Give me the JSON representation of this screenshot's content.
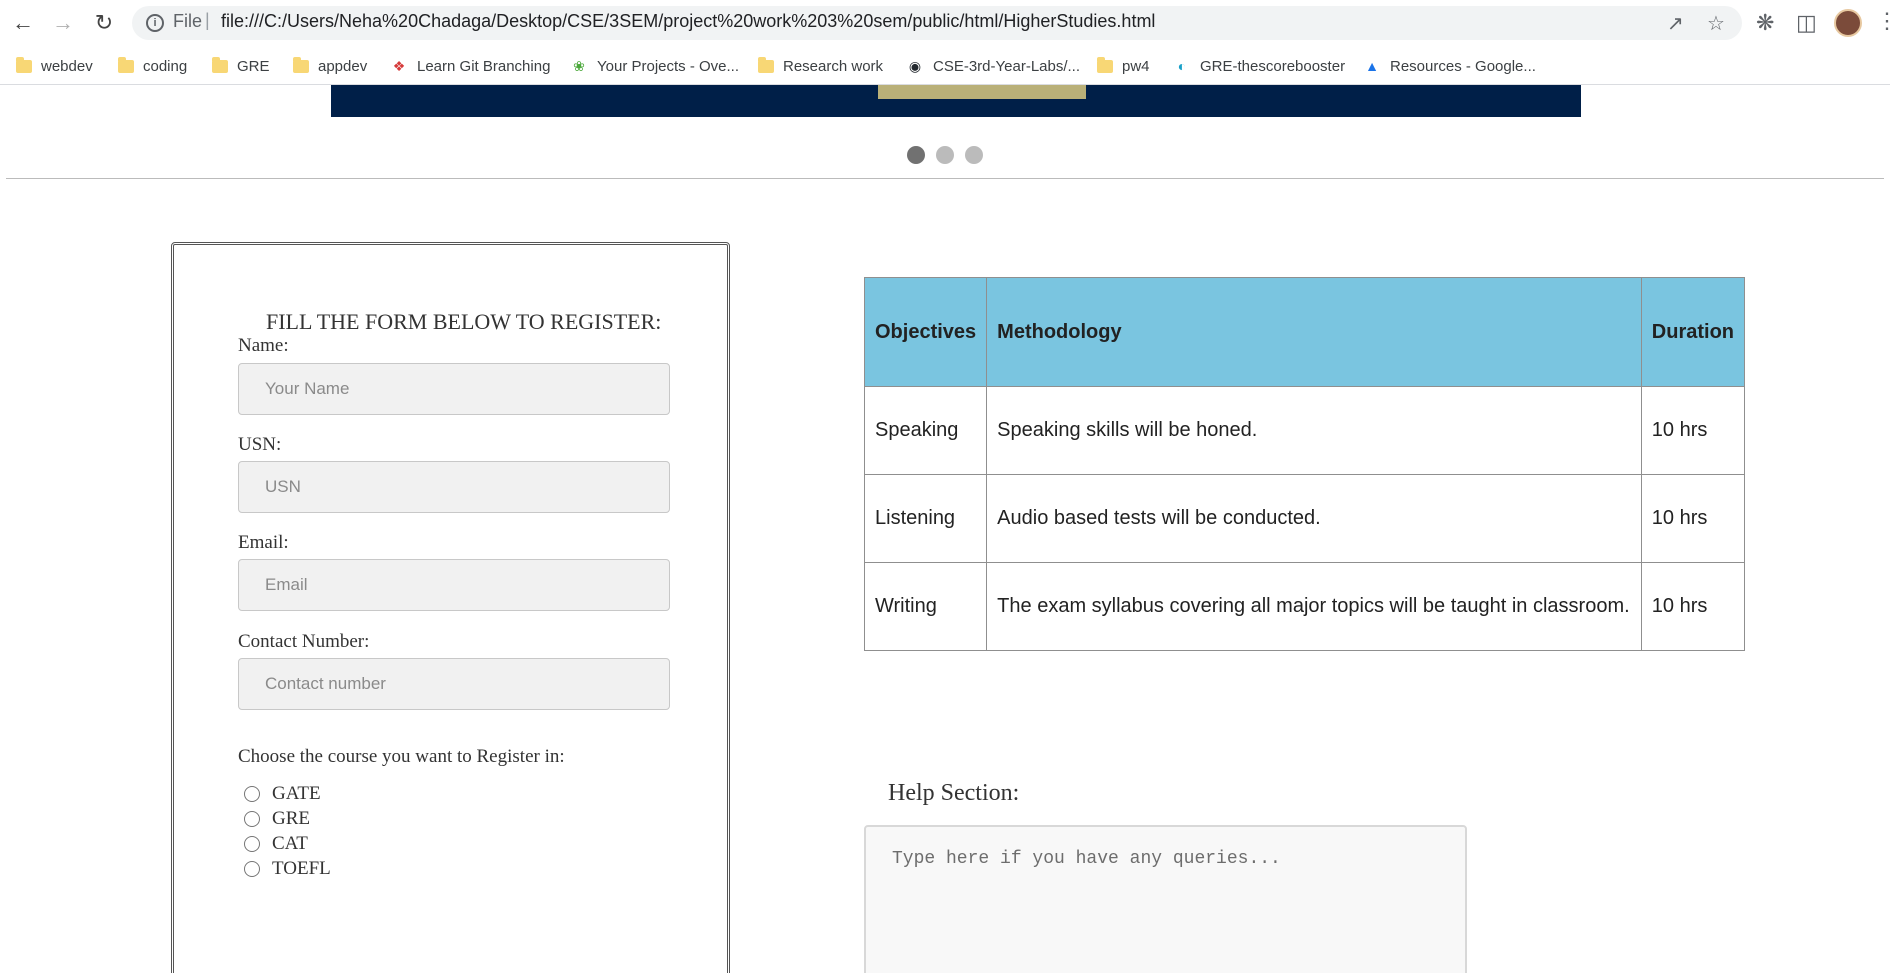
{
  "browser": {
    "url_scheme": "File",
    "url": "file:///C:/Users/Neha%20Chadaga/Desktop/CSE/3SEM/project%20work%203%20sem/public/html/HigherStudies.html",
    "bookmarks": [
      {
        "label": "webdev",
        "icon": "folder-icon"
      },
      {
        "label": "coding",
        "icon": "folder-icon"
      },
      {
        "label": "GRE",
        "icon": "folder-icon"
      },
      {
        "label": "appdev",
        "icon": "folder-icon"
      },
      {
        "label": "Learn Git Branching",
        "icon": "git-branch-icon"
      },
      {
        "label": "Your Projects - Ove...",
        "icon": "leaf-icon"
      },
      {
        "label": "Research work",
        "icon": "folder-icon"
      },
      {
        "label": "CSE-3rd-Year-Labs/...",
        "icon": "github-icon"
      },
      {
        "label": "pw4",
        "icon": "folder-icon"
      },
      {
        "label": "GRE-thescorebooster",
        "icon": "gauge-icon"
      },
      {
        "label": "Resources - Google...",
        "icon": "google-drive-icon"
      }
    ]
  },
  "carousel": {
    "slide_count": 3,
    "active_index": 0,
    "banner_color": "#001f48",
    "button_color": "#b9b078"
  },
  "form": {
    "title": "FILL THE FORM BELOW TO REGISTER:",
    "name_label": "Name:",
    "name_placeholder": "Your Name",
    "usn_label": "USN:",
    "usn_placeholder": "USN",
    "email_label": "Email:",
    "email_placeholder": "Email",
    "contact_label": "Contact Number:",
    "contact_placeholder": "Contact number",
    "course_prompt": "Choose the course you want to Register in:",
    "courses": [
      "GATE",
      "GRE",
      "CAT",
      "TOEFL"
    ]
  },
  "table": {
    "header_color": "#7ac5e0",
    "headers": [
      "Objectives",
      "Methodology",
      "Duration"
    ],
    "rows": [
      [
        "Speaking",
        "Speaking skills will be honed.",
        "10 hrs"
      ],
      [
        "Listening",
        "Audio based tests will be conducted.",
        "10 hrs"
      ],
      [
        "Writing",
        "The exam syllabus covering all major topics will be taught in classroom.",
        "10 hrs"
      ]
    ]
  },
  "help": {
    "label": "Help Section:",
    "placeholder": "Type here if you have any queries..."
  }
}
